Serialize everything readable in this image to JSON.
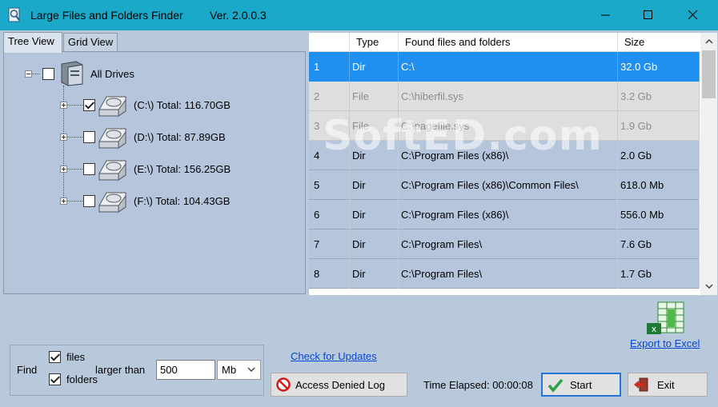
{
  "titlebar": {
    "title": "Large Files and Folders Finder",
    "version": "Ver. 2.0.0.3"
  },
  "tabs": [
    {
      "label": "Tree View",
      "active": true
    },
    {
      "label": "Grid View",
      "active": false
    }
  ],
  "tree": {
    "root": {
      "label": "All Drives",
      "checked": false
    },
    "drives": [
      {
        "label": "(C:\\)  Total: 116.70GB",
        "checked": true
      },
      {
        "label": "(D:\\)  Total: 87.89GB",
        "checked": false
      },
      {
        "label": "(E:\\)  Total: 156.25GB",
        "checked": false
      },
      {
        "label": "(F:\\)  Total: 104.43GB",
        "checked": false
      }
    ]
  },
  "grid": {
    "columns": [
      "",
      "Type",
      "Found files and folders",
      "Size"
    ],
    "rows": [
      {
        "num": "1",
        "type": "Dir",
        "path": "C:\\",
        "size": "32.0 Gb"
      },
      {
        "num": "2",
        "type": "File",
        "path": "C:\\hiberfil.sys",
        "size": "3.2 Gb"
      },
      {
        "num": "3",
        "type": "File",
        "path": "C:\\pagefile.sys",
        "size": "1.9 Gb"
      },
      {
        "num": "4",
        "type": "Dir",
        "path": "C:\\Program Files (x86)\\",
        "size": "2.0 Gb"
      },
      {
        "num": "5",
        "type": "Dir",
        "path": "C:\\Program Files (x86)\\Common Files\\",
        "size": "618.0 Mb"
      },
      {
        "num": "6",
        "type": "Dir",
        "path": "C:\\Program Files (x86)\\",
        "size": "556.0 Mb"
      },
      {
        "num": "7",
        "type": "Dir",
        "path": "C:\\Program Files\\",
        "size": "7.6 Gb"
      },
      {
        "num": "8",
        "type": "Dir",
        "path": "C:\\Program Files\\",
        "size": "1.7 Gb"
      }
    ]
  },
  "find": {
    "label": "Find",
    "files_label": "files",
    "folders_label": "folders",
    "files_checked": true,
    "folders_checked": true,
    "larger_than_label": "larger than",
    "size_value": "500",
    "unit": "Mb"
  },
  "links": {
    "check_updates": "Check for Updates",
    "export_excel": "Export to Excel"
  },
  "buttons": {
    "access_denied": "Access Denied Log",
    "start": "Start",
    "exit": "Exit"
  },
  "status": {
    "time_elapsed": "Time Elapsed: 00:00:08"
  },
  "watermark": "SoftED.com",
  "colors": {
    "titlebar": "#1ba9c9",
    "selected_row": "#1f8ff0",
    "panel": "#b9c9dc"
  }
}
